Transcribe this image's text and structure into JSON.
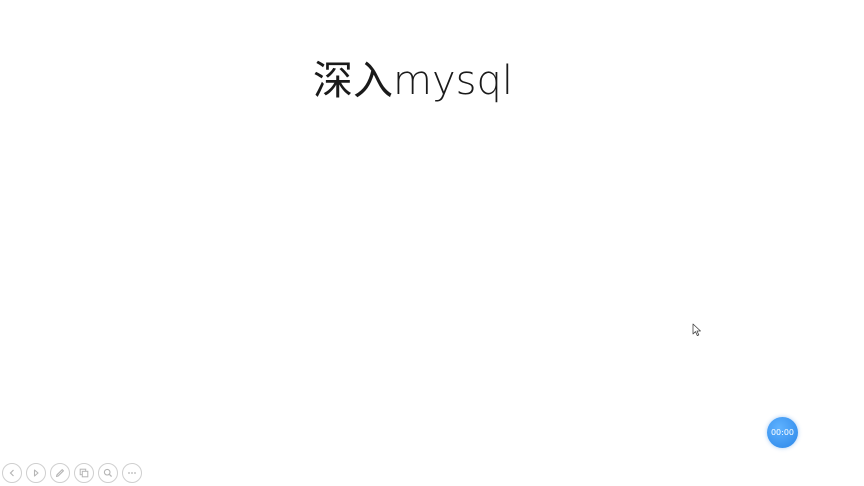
{
  "slide": {
    "title": "深入mysql"
  },
  "timer": {
    "label": "00:00",
    "color": "#3a93ef"
  },
  "toolbar": {
    "buttons": [
      {
        "name": "previous-icon"
      },
      {
        "name": "next-icon"
      },
      {
        "name": "pen-icon"
      },
      {
        "name": "slides-overview-icon"
      },
      {
        "name": "zoom-icon"
      },
      {
        "name": "more-options-icon"
      }
    ]
  }
}
